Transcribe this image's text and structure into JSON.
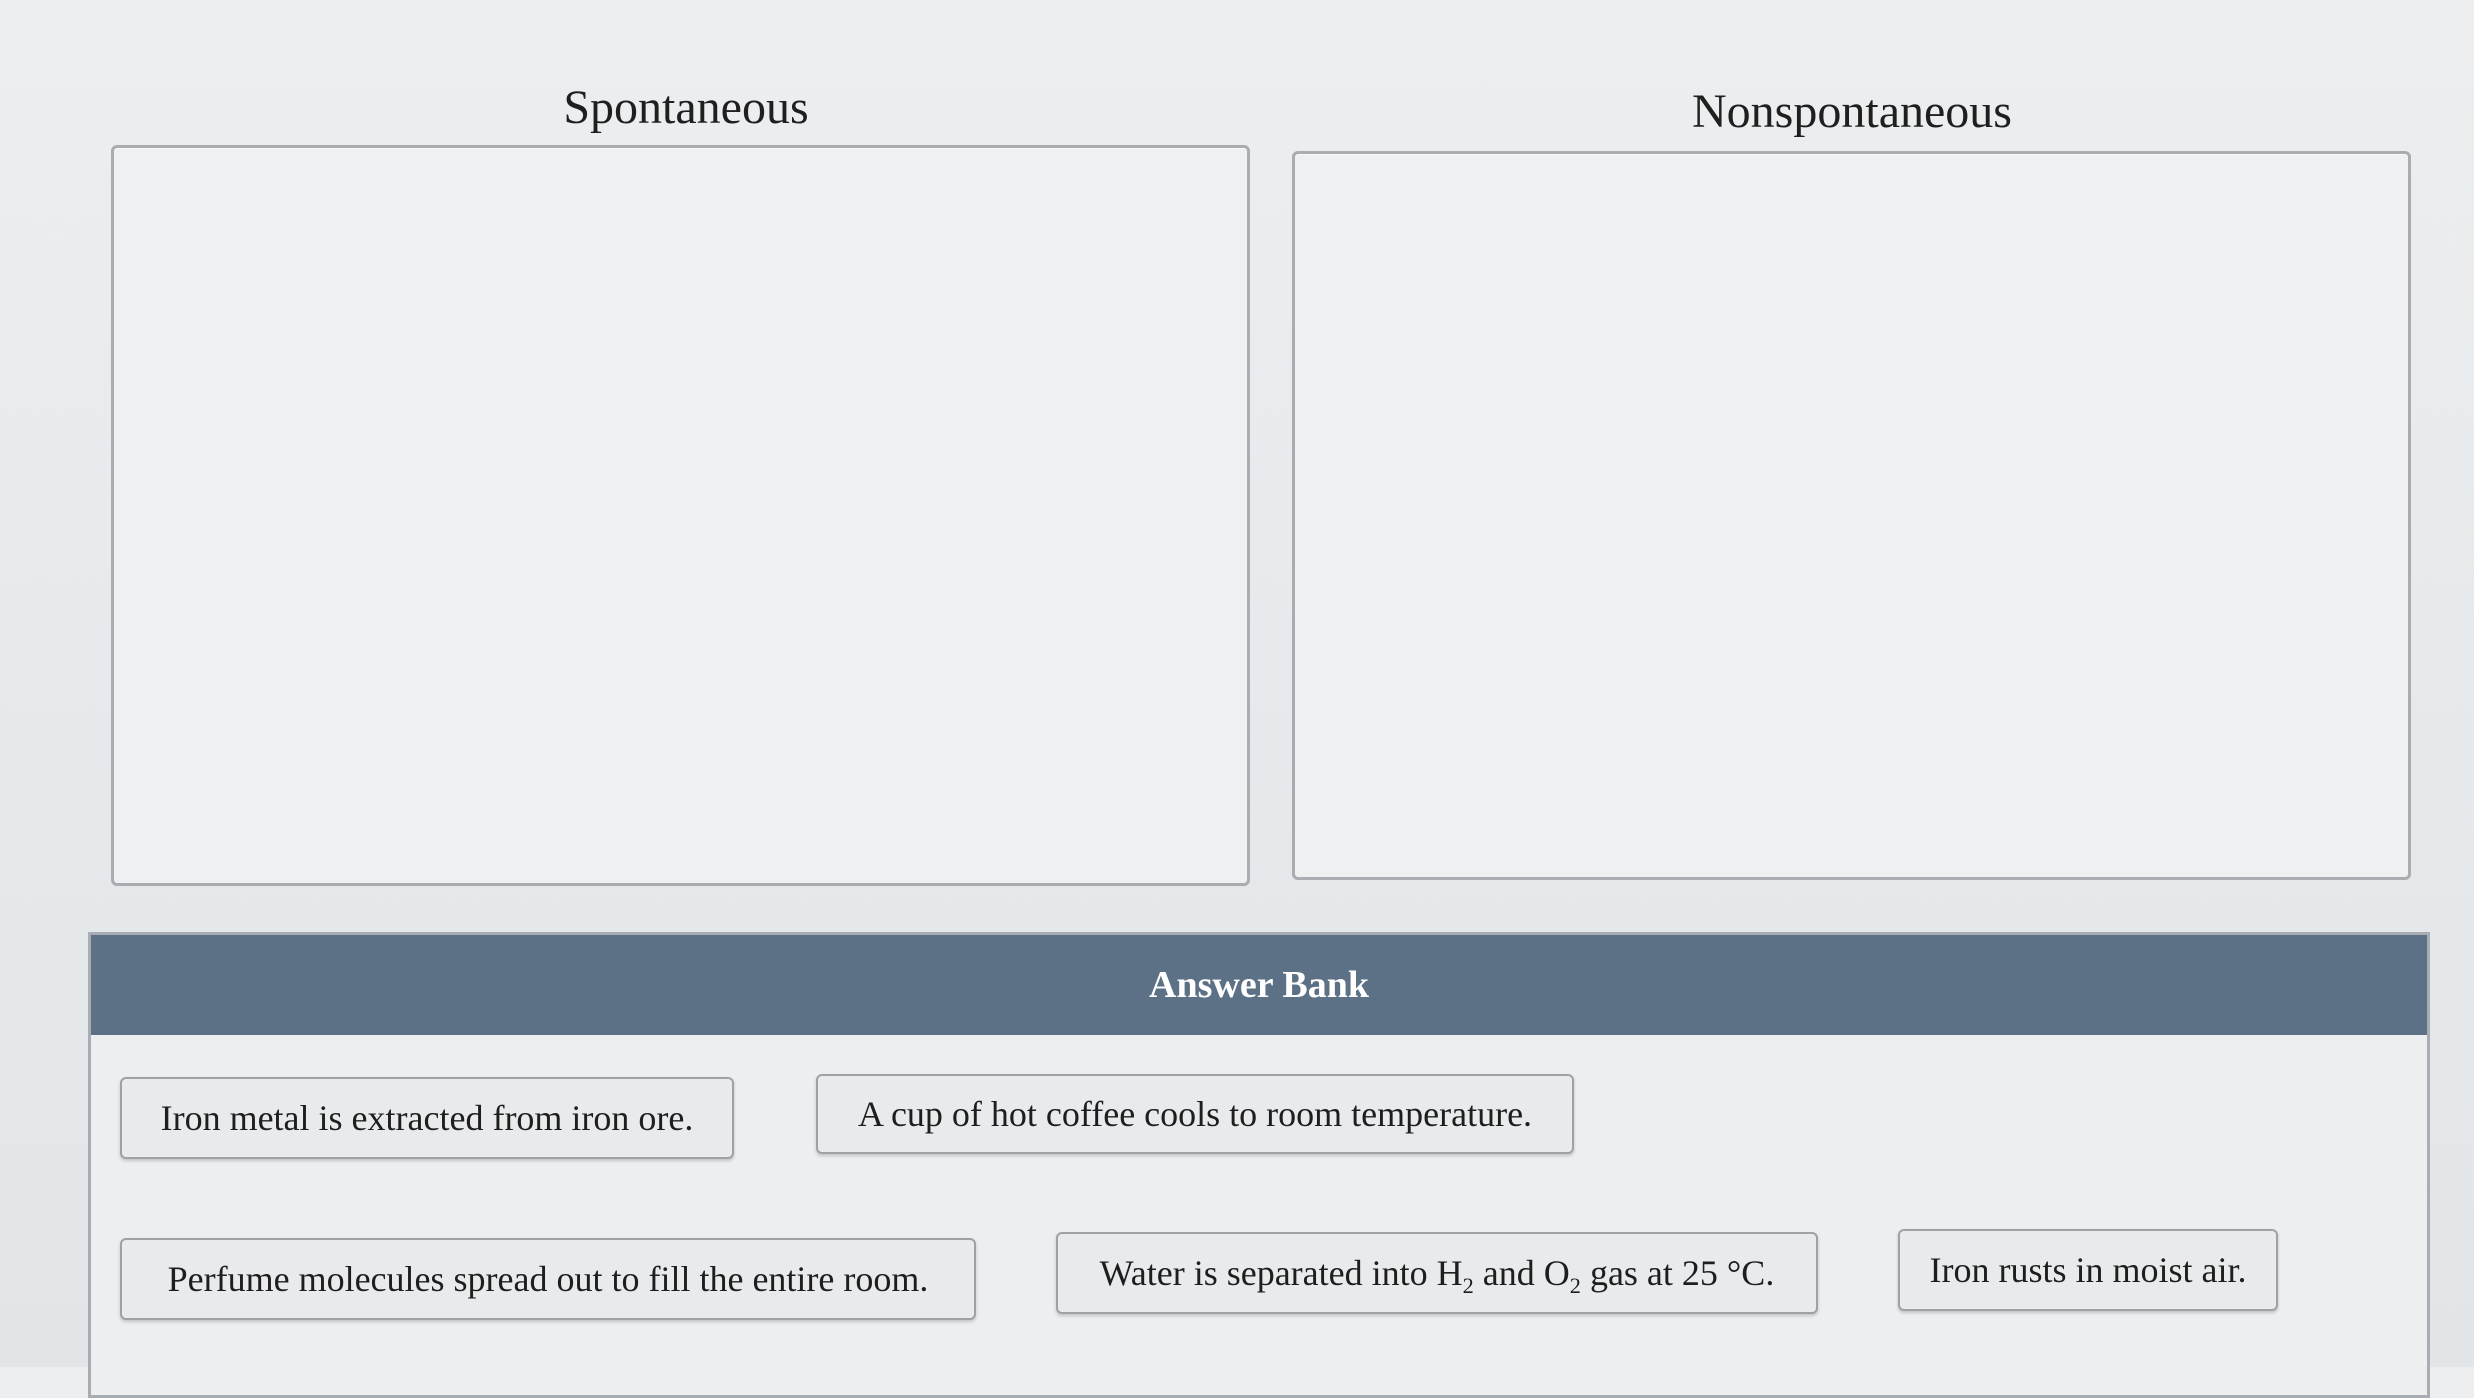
{
  "categories": {
    "spontaneous": {
      "label": "Spontaneous"
    },
    "nonspontaneous": {
      "label": "Nonspontaneous"
    }
  },
  "answer_bank": {
    "title": "Answer Bank",
    "items": [
      {
        "text": "Iron metal is extracted from iron ore."
      },
      {
        "text": "A cup of hot coffee cools to room temperature."
      },
      {
        "text": "Perfume molecules spread out to fill the entire room."
      },
      {
        "parts": {
          "a": "Water is separated into H",
          "sub1": "2",
          "b": " and O",
          "sub2": "2",
          "c": " gas at 25 °C."
        }
      },
      {
        "text": "Iron rusts in moist air."
      }
    ]
  },
  "colors": {
    "header_bg": "#5c7186",
    "chip_bg": "#e8eaec",
    "zone_border": "#a9adb1"
  }
}
